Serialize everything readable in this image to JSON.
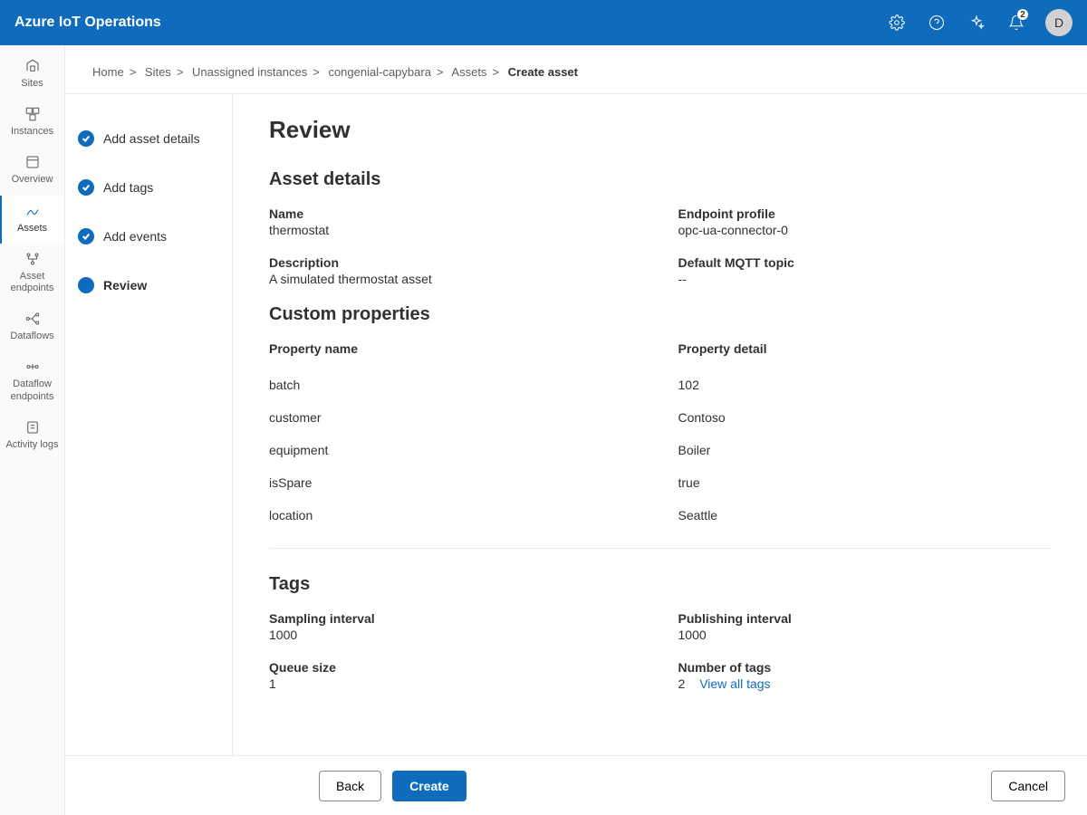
{
  "header": {
    "title": "Azure IoT Operations",
    "notif_count": "2",
    "avatar_initial": "D"
  },
  "nav": {
    "items": [
      {
        "label": "Sites"
      },
      {
        "label": "Instances"
      },
      {
        "label": "Overview"
      },
      {
        "label": "Assets"
      },
      {
        "label": "Asset endpoints"
      },
      {
        "label": "Dataflows"
      },
      {
        "label": "Dataflow endpoints"
      },
      {
        "label": "Activity logs"
      }
    ]
  },
  "breadcrumb": {
    "items": [
      "Home",
      "Sites",
      "Unassigned instances",
      "congenial-capybara",
      "Assets"
    ],
    "current": "Create asset"
  },
  "steps": [
    {
      "label": "Add asset details",
      "state": "done"
    },
    {
      "label": "Add tags",
      "state": "done"
    },
    {
      "label": "Add events",
      "state": "done"
    },
    {
      "label": "Review",
      "state": "current"
    }
  ],
  "review": {
    "title": "Review",
    "asset_details_heading": "Asset details",
    "name_label": "Name",
    "name_value": "thermostat",
    "endpoint_label": "Endpoint profile",
    "endpoint_value": "opc-ua-connector-0",
    "description_label": "Description",
    "description_value": "A simulated thermostat asset",
    "mqtt_label": "Default MQTT topic",
    "mqtt_value": "--",
    "custom_props_heading": "Custom properties",
    "prop_name_header": "Property name",
    "prop_detail_header": "Property detail",
    "props": [
      {
        "name": "batch",
        "detail": "102"
      },
      {
        "name": "customer",
        "detail": "Contoso"
      },
      {
        "name": "equipment",
        "detail": "Boiler"
      },
      {
        "name": "isSpare",
        "detail": "true"
      },
      {
        "name": "location",
        "detail": "Seattle"
      }
    ],
    "tags_heading": "Tags",
    "sampling_label": "Sampling interval",
    "sampling_value": "1000",
    "publishing_label": "Publishing interval",
    "publishing_value": "1000",
    "queue_label": "Queue size",
    "queue_value": "1",
    "numtags_label": "Number of tags",
    "numtags_value": "2",
    "view_all_tags": "View all tags"
  },
  "footer": {
    "back": "Back",
    "create": "Create",
    "cancel": "Cancel"
  }
}
